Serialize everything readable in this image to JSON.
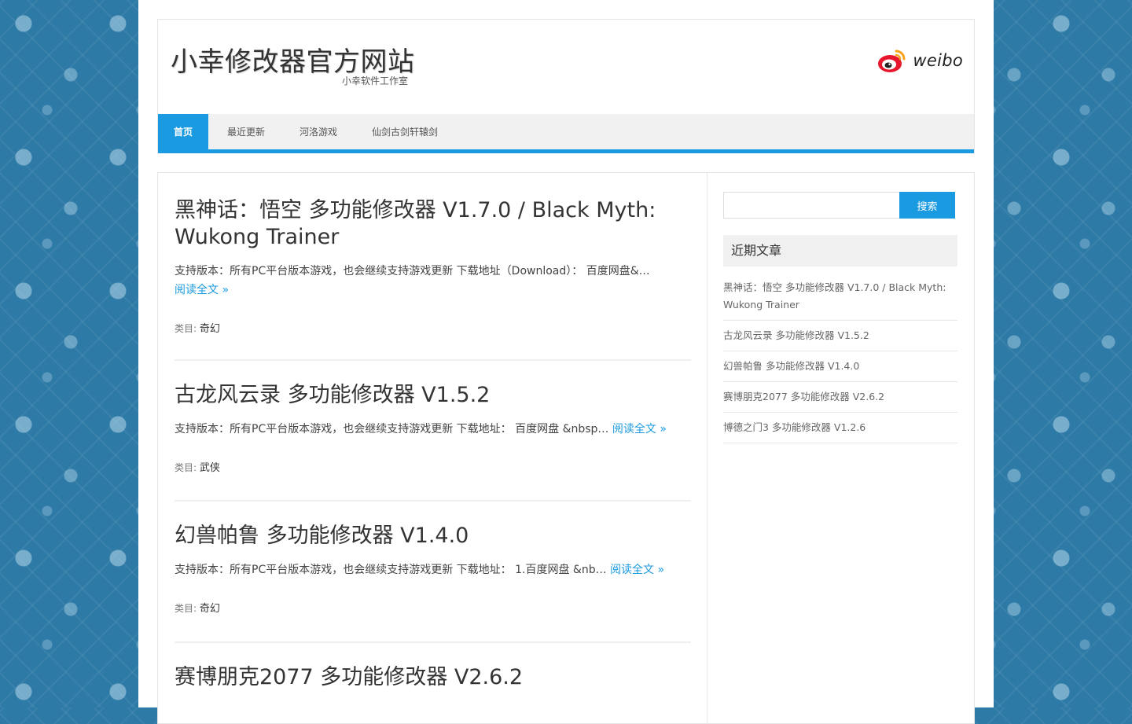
{
  "site": {
    "title": "小幸修改器官方网站",
    "description": "小幸软件工作室",
    "weibo_text": "weibo"
  },
  "nav": {
    "items": [
      {
        "label": "首页",
        "active": true
      },
      {
        "label": "最近更新"
      },
      {
        "label": "河洛游戏"
      },
      {
        "label": "仙剑古剑轩辕剑"
      }
    ]
  },
  "posts": [
    {
      "title": "黑神话：悟空 多功能修改器 V1.7.0 / Black Myth: Wukong Trainer",
      "excerpt": "支持版本：所有PC平台版本游戏，也会继续支持游戏更新 下载地址（Download）：   百度网盘&…",
      "more": "阅读全文 »",
      "cat_label": "类目:",
      "cat": "奇幻"
    },
    {
      "title": "古龙风云录 多功能修改器 V1.5.2",
      "excerpt": "支持版本：所有PC平台版本游戏，也会继续支持游戏更新 下载地址：   百度网盘 &nbsp…",
      "more": "阅读全文 »",
      "cat_label": "类目:",
      "cat": "武侠"
    },
    {
      "title": "幻兽帕鲁 多功能修改器 V1.4.0",
      "excerpt": "支持版本：所有PC平台版本游戏，也会继续支持游戏更新 下载地址：   1.百度网盘 &nb…",
      "more": "阅读全文 »",
      "cat_label": "类目:",
      "cat": "奇幻"
    },
    {
      "title": "赛博朋克2077 多功能修改器 V2.6.2"
    }
  ],
  "sidebar": {
    "search_button": "搜索",
    "search_value": "",
    "recent_title": "近期文章",
    "recent": [
      "黑神话：悟空 多功能修改器 V1.7.0 / Black Myth: Wukong Trainer",
      "古龙风云录 多功能修改器 V1.5.2",
      "幻兽帕鲁 多功能修改器 V1.4.0",
      "赛博朋克2077 多功能修改器 V2.6.2",
      "博德之门3 多功能修改器 V1.2.6"
    ]
  },
  "colors": {
    "accent": "#1a9ae0",
    "background": "#2e7aa6"
  }
}
